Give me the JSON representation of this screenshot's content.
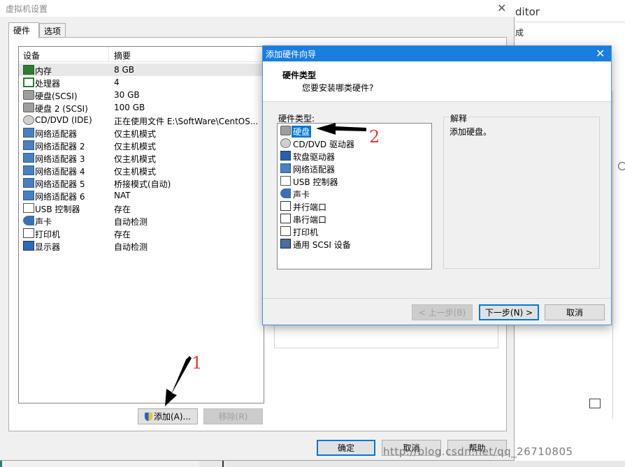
{
  "background": {
    "editor_label": "ditor",
    "cheng": "成"
  },
  "settings": {
    "title": "虚拟机设置",
    "tabs": [
      "硬件",
      "选项"
    ],
    "columns": [
      "设备",
      "摘要"
    ],
    "devices": [
      {
        "icon": "memory-icon",
        "name": "内存",
        "summary": "8 GB"
      },
      {
        "icon": "processor-icon",
        "name": "处理器",
        "summary": "4"
      },
      {
        "icon": "hard-disk-icon",
        "name": "硬盘(SCSI)",
        "summary": "30 GB"
      },
      {
        "icon": "hard-disk-icon",
        "name": "硬盘 2 (SCSI)",
        "summary": "100 GB"
      },
      {
        "icon": "cd-dvd-icon",
        "name": "CD/DVD (IDE)",
        "summary": "正在使用文件 E:\\SoftWare\\CentOS..."
      },
      {
        "icon": "network-adapter-icon",
        "name": "网络适配器",
        "summary": "仅主机模式"
      },
      {
        "icon": "network-adapter-icon",
        "name": "网络适配器 2",
        "summary": "仅主机模式"
      },
      {
        "icon": "network-adapter-icon",
        "name": "网络适配器 3",
        "summary": "仅主机模式"
      },
      {
        "icon": "network-adapter-icon",
        "name": "网络适配器 4",
        "summary": "仅主机模式"
      },
      {
        "icon": "network-adapter-icon",
        "name": "网络适配器 5",
        "summary": "桥接模式(自动)"
      },
      {
        "icon": "network-adapter-icon",
        "name": "网络适配器 6",
        "summary": "NAT"
      },
      {
        "icon": "usb-controller-icon",
        "name": "USB 控制器",
        "summary": "存在"
      },
      {
        "icon": "sound-card-icon",
        "name": "声卡",
        "summary": "自动检测"
      },
      {
        "icon": "printer-icon",
        "name": "打印机",
        "summary": "存在"
      },
      {
        "icon": "display-icon",
        "name": "显示器",
        "summary": "自动检测"
      }
    ],
    "add_button": "添加(A)...",
    "remove_button": "移除(R)",
    "ok_button": "确定",
    "cancel_button": "取消",
    "help_button": "帮助"
  },
  "wizard": {
    "title": "添加硬件向导",
    "heading": "硬件类型",
    "subheading": "您要安装哪类硬件?",
    "list_label": "硬件类型:",
    "desc_label": "解释",
    "desc_text": "添加硬盘。",
    "hardware_types": [
      {
        "icon": "hard-disk-icon",
        "name": "硬盘"
      },
      {
        "icon": "cd-dvd-icon",
        "name": "CD/DVD 驱动器"
      },
      {
        "icon": "floppy-icon",
        "name": "软盘驱动器"
      },
      {
        "icon": "network-adapter-icon",
        "name": "网络适配器"
      },
      {
        "icon": "usb-controller-icon",
        "name": "USB 控制器"
      },
      {
        "icon": "sound-card-icon",
        "name": "声卡"
      },
      {
        "icon": "parallel-port-icon",
        "name": "并行端口"
      },
      {
        "icon": "serial-port-icon",
        "name": "串行端口"
      },
      {
        "icon": "printer-icon",
        "name": "打印机"
      },
      {
        "icon": "scsi-device-icon",
        "name": "通用 SCSI 设备"
      }
    ],
    "selected_index": 0,
    "back_button": "< 上一步(B)",
    "next_button": "下一步(N) >",
    "cancel_button": "取消"
  },
  "annotations": {
    "one": "1",
    "two": "2"
  },
  "watermark": "http://blog.csdn.net/qq_26710805",
  "colors": {
    "accent": "#0078d7",
    "wizard_title": "#1a7de0",
    "annotation": "#e53935"
  }
}
